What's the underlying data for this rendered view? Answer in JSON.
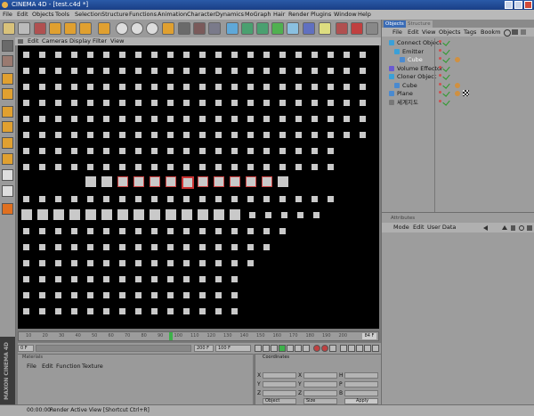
{
  "window": {
    "title": "CINEMA 4D - [test.c4d *]"
  },
  "menubar": {
    "items": [
      "File",
      "Edit",
      "Objects",
      "Tools",
      "Selection",
      "Structure",
      "Functions",
      "Animation",
      "Character",
      "Dynamics",
      "MoGraph",
      "Hair",
      "Render",
      "Plugins",
      "Window",
      "Help"
    ]
  },
  "viewport_menu": {
    "items": [
      "Edit",
      "Cameras",
      "Display",
      "Filter",
      "View"
    ]
  },
  "timeline": {
    "ticks": [
      "10",
      "20",
      "30",
      "40",
      "50",
      "60",
      "70",
      "80",
      "90",
      "100",
      "110",
      "120",
      "130",
      "140",
      "150",
      "160",
      "170",
      "180",
      "190",
      "200"
    ],
    "end_frame": "84 F"
  },
  "transport": {
    "start": "0 F",
    "current": "",
    "end": "200 F",
    "current2": "100 F"
  },
  "materials": {
    "header": "Materials",
    "menu": [
      "File",
      "Edit",
      "Function",
      "Texture"
    ]
  },
  "coordinates": {
    "header": "Coordinates",
    "rows": [
      {
        "a": "X",
        "av": "",
        "b": "X",
        "bv": "",
        "c": "H",
        "cv": ""
      },
      {
        "a": "Y",
        "av": "",
        "b": "Y",
        "bv": "",
        "c": "P",
        "cv": ""
      },
      {
        "a": "Z",
        "av": "",
        "b": "Z",
        "bv": "",
        "c": "B",
        "cv": ""
      }
    ],
    "mode_object": "Object",
    "mode_size": "Size",
    "apply_label": "Apply"
  },
  "maxon": {
    "label": "MAXON CINEMA 4D"
  },
  "status": {
    "time": "00:00:00",
    "text": "Render Active View [Shortcut Ctrl+R]"
  },
  "object_manager": {
    "tabs": [
      "Objects",
      "Structure"
    ],
    "menu": [
      "File",
      "Edit",
      "View",
      "Objects",
      "Tags",
      "Bookm"
    ],
    "items": [
      {
        "name": "Connect Object",
        "indent": 0,
        "color": "#3aa0d8"
      },
      {
        "name": "Emitter",
        "indent": 1,
        "color": "#3aa0d8"
      },
      {
        "name": "Cube",
        "indent": 2,
        "color": "#4a8ad0"
      },
      {
        "name": "Volume Effector",
        "indent": 0,
        "color": "#6a5ad0"
      },
      {
        "name": "Cloner Object",
        "indent": 0,
        "color": "#3aa0d8"
      },
      {
        "name": "Cube",
        "indent": 1,
        "color": "#4a8ad0"
      },
      {
        "name": "Plane",
        "indent": 0,
        "color": "#4a8ad0"
      },
      {
        "name": "세계지도",
        "indent": 0,
        "color": "#777777"
      }
    ]
  },
  "attributes": {
    "header": "Attributes",
    "menu": [
      "Mode",
      "Edit",
      "User Data"
    ]
  },
  "colors": {
    "accent": "#3a6bb5",
    "playhead": "#3db14a",
    "selection": "#cc4444"
  }
}
